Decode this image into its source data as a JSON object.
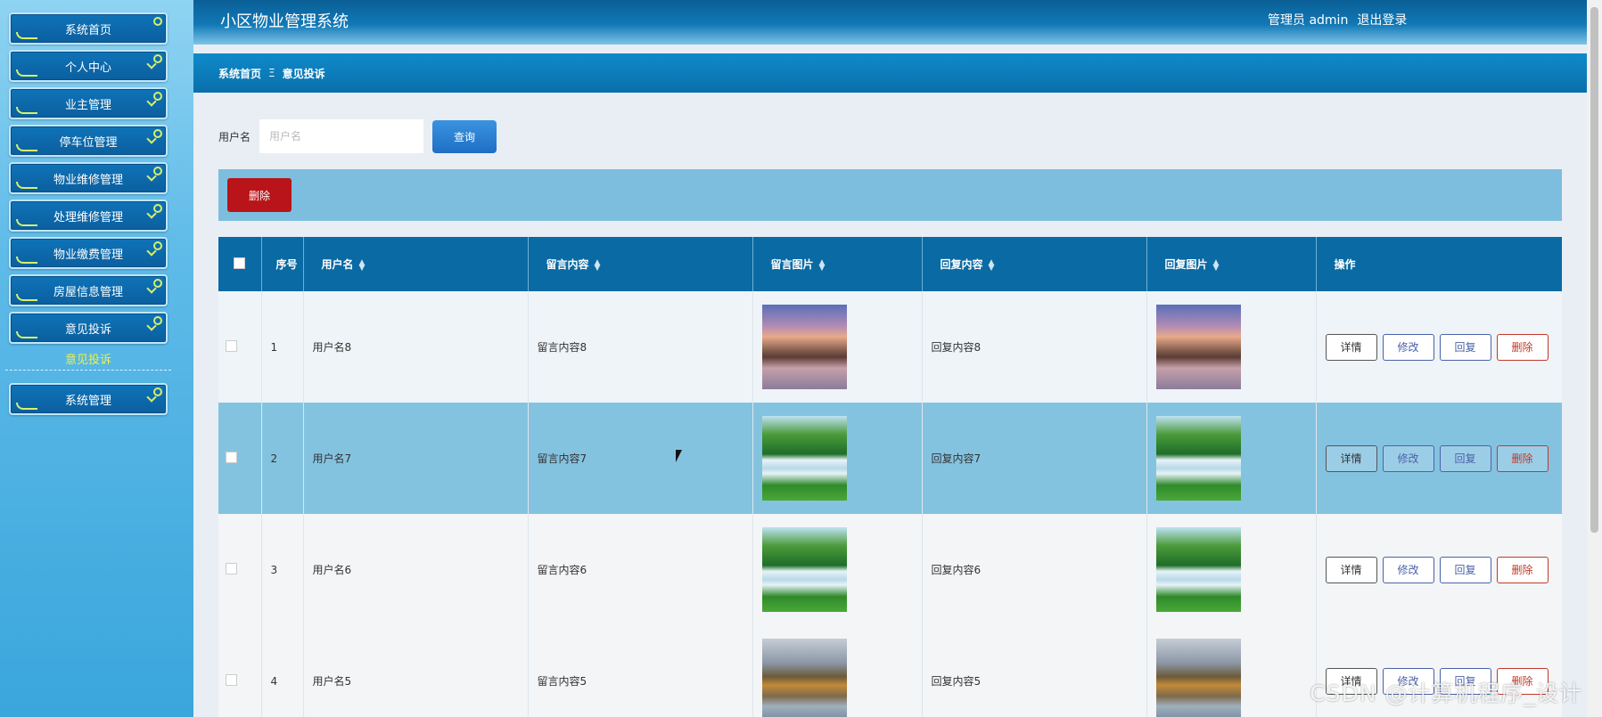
{
  "app": {
    "title": "小区物业管理系统",
    "user_label": "管理员 admin",
    "logout_label": "退出登录"
  },
  "sidebar": {
    "items": [
      {
        "label": "系统首页"
      },
      {
        "label": "个人中心"
      },
      {
        "label": "业主管理"
      },
      {
        "label": "停车位管理"
      },
      {
        "label": "物业维修管理"
      },
      {
        "label": "处理维修管理"
      },
      {
        "label": "物业缴费管理"
      },
      {
        "label": "房屋信息管理"
      },
      {
        "label": "意见投诉"
      },
      {
        "label": "系统管理"
      }
    ],
    "sub_item": "意见投诉"
  },
  "breadcrumb": {
    "home": "系统首页",
    "separator": "Ξ",
    "current": "意见投诉"
  },
  "search": {
    "label": "用户名",
    "placeholder": "用户名",
    "button": "查询"
  },
  "actions": {
    "batch_delete": "删除"
  },
  "table": {
    "headers": {
      "index": "序号",
      "username": "用户名",
      "content": "留言内容",
      "image": "留言图片",
      "reply": "回复内容",
      "reply_image": "回复图片",
      "ops": "操作"
    },
    "op_labels": {
      "detail": "详情",
      "edit": "修改",
      "reply": "回复",
      "delete": "删除"
    },
    "rows": [
      {
        "index": "1",
        "username": "用户名8",
        "content": "留言内容8",
        "reply": "回复内容8",
        "image": "mountain",
        "reply_image": "mountain"
      },
      {
        "index": "2",
        "username": "用户名7",
        "content": "留言内容7",
        "reply": "回复内容7",
        "image": "falls",
        "reply_image": "falls"
      },
      {
        "index": "3",
        "username": "用户名6",
        "content": "留言内容6",
        "reply": "回复内容6",
        "image": "falls",
        "reply_image": "falls"
      },
      {
        "index": "4",
        "username": "用户名5",
        "content": "留言内容5",
        "reply": "回复内容5",
        "image": "lake",
        "reply_image": "lake"
      }
    ]
  },
  "watermark": "CSDN @计算机程序_设计",
  "colors": {
    "header": "#0a5f96",
    "breadcrumb": "#0f8ac9",
    "table_head": "#0a6aa3",
    "danger": "#b8141a",
    "primary": "#1e6fc5"
  }
}
